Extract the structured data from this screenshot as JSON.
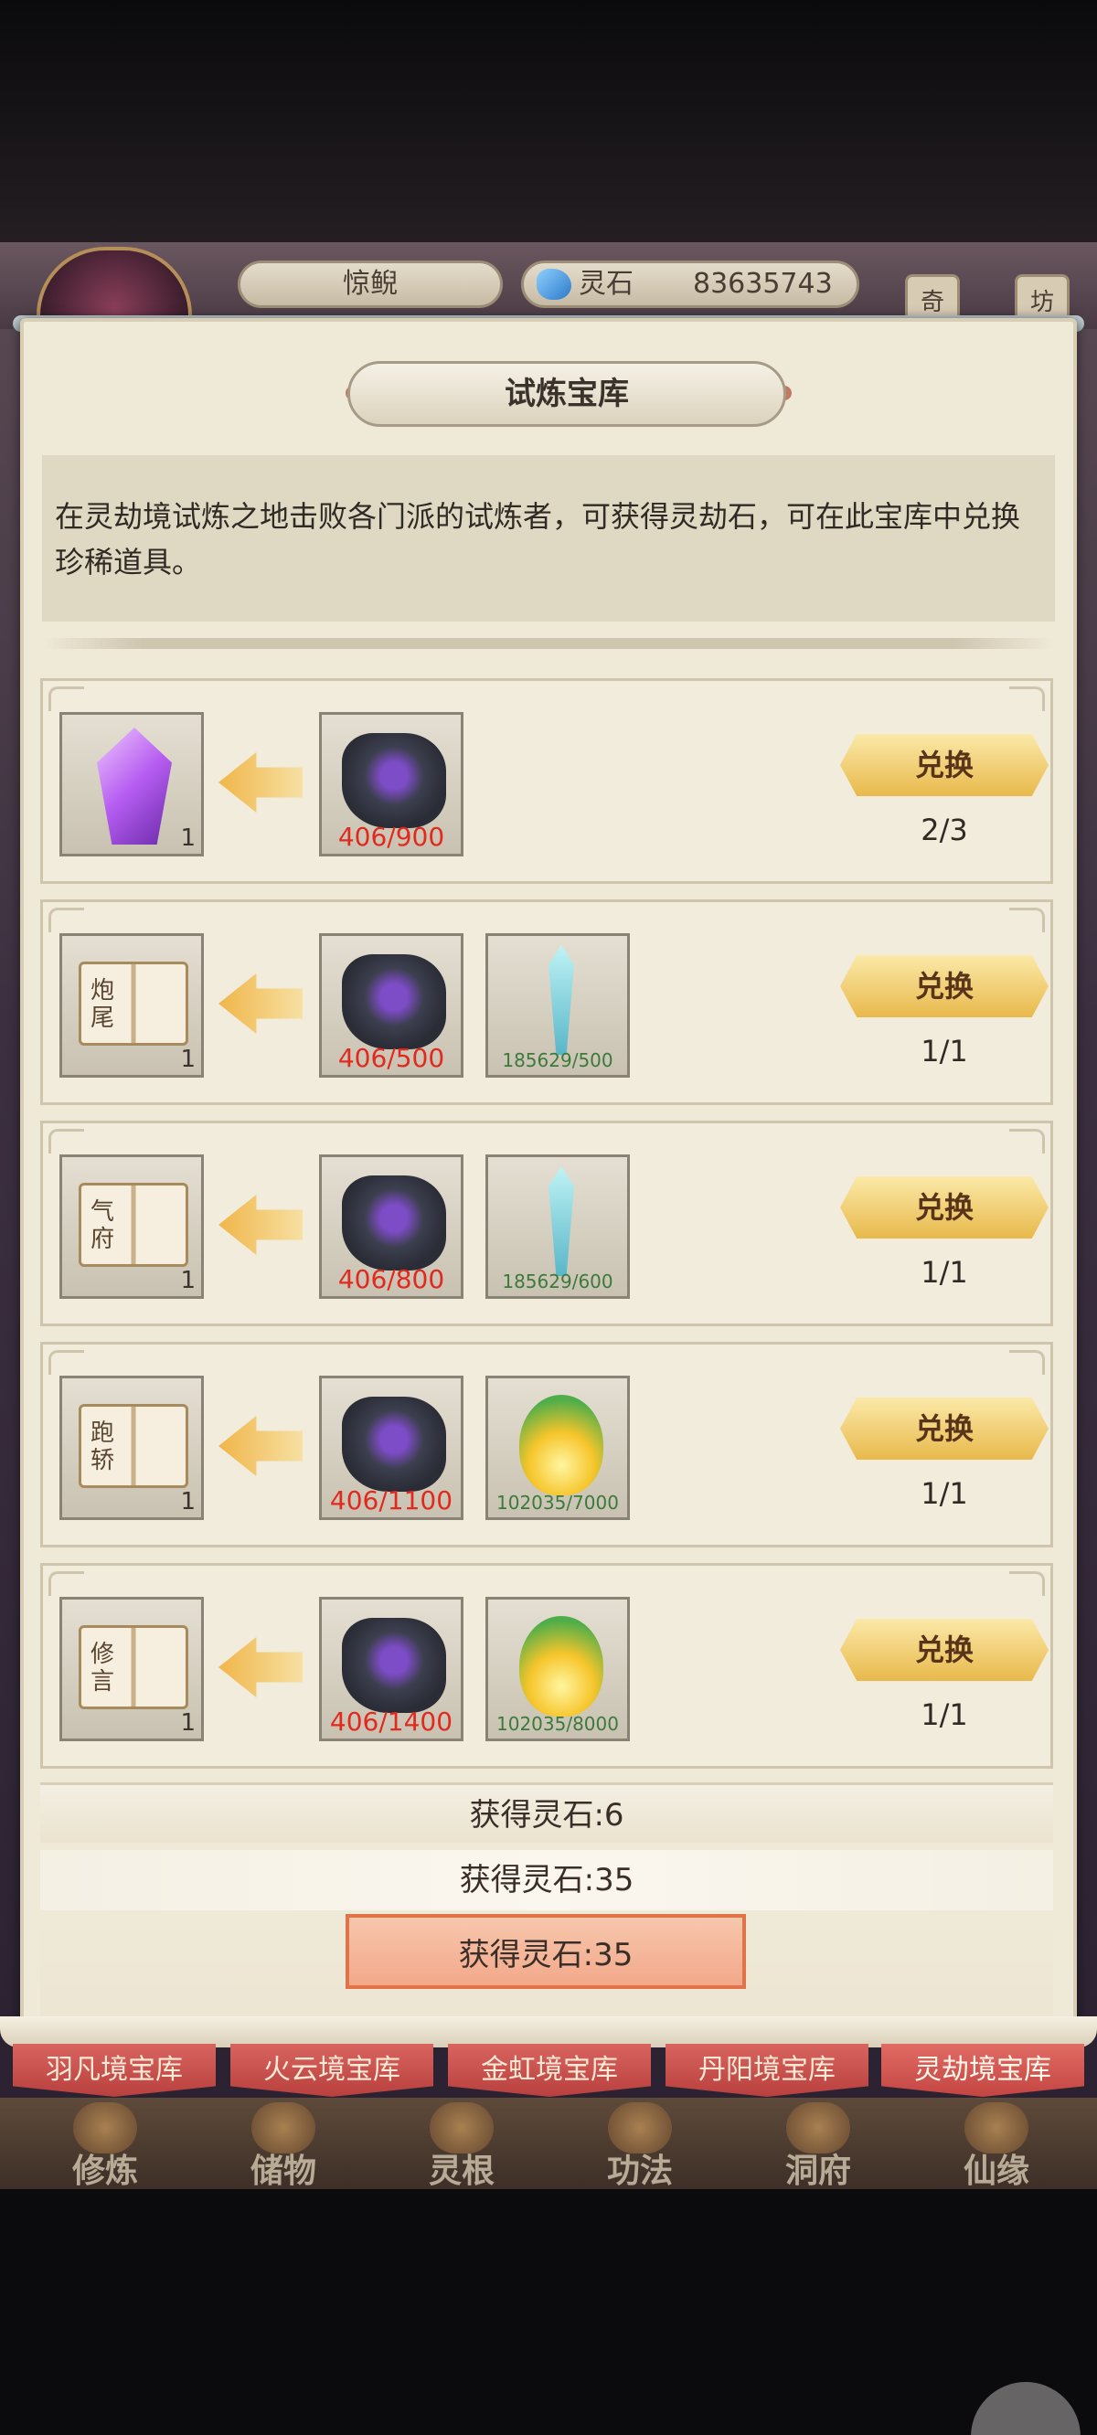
{
  "header": {
    "player_name": "惊鲵",
    "currency_label": "灵石",
    "currency_value": "83635743",
    "side_tags": [
      "奇",
      "坊"
    ]
  },
  "panel": {
    "title": "试炼宝库",
    "description": "在灵劫境试炼之地击败各门派的试炼者，可获得灵劫石，可在此宝库中兑换珍稀道具。"
  },
  "exchange_rows": [
    {
      "reward": {
        "icon": "purple-crystal-icon",
        "qty": "1",
        "glyph": ""
      },
      "costs": [
        {
          "icon": "spirit-rock-icon",
          "progress": "406/900"
        }
      ],
      "button": "兑换",
      "limit": "2/3"
    },
    {
      "reward": {
        "icon": "skill-book-icon",
        "qty": "1",
        "glyph": "炮尾"
      },
      "costs": [
        {
          "icon": "spirit-rock-icon",
          "progress": "406/500"
        },
        {
          "icon": "jade-sword-icon",
          "progress": "185629/500"
        }
      ],
      "button": "兑换",
      "limit": "1/1"
    },
    {
      "reward": {
        "icon": "skill-book-icon",
        "qty": "1",
        "glyph": "气府"
      },
      "costs": [
        {
          "icon": "spirit-rock-icon",
          "progress": "406/800"
        },
        {
          "icon": "jade-sword-icon",
          "progress": "185629/600"
        }
      ],
      "button": "兑换",
      "limit": "1/1"
    },
    {
      "reward": {
        "icon": "skill-book-icon",
        "qty": "1",
        "glyph": "跑轿"
      },
      "costs": [
        {
          "icon": "spirit-rock-icon",
          "progress": "406/1100"
        },
        {
          "icon": "spirit-fire-icon",
          "progress": "102035/7000"
        }
      ],
      "button": "兑换",
      "limit": "1/1"
    },
    {
      "reward": {
        "icon": "skill-book-icon",
        "qty": "1",
        "glyph": "修言"
      },
      "costs": [
        {
          "icon": "spirit-rock-icon",
          "progress": "406/1400"
        },
        {
          "icon": "spirit-fire-icon",
          "progress": "102035/8000"
        }
      ],
      "button": "兑换",
      "limit": "1/1"
    }
  ],
  "toasts": [
    "获得灵石:6",
    "获得灵石:35",
    "获得灵石:35"
  ],
  "tabs": [
    "羽凡境宝库",
    "火云境宝库",
    "金虹境宝库",
    "丹阳境宝库",
    "灵劫境宝库"
  ],
  "active_tab": "灵劫境宝库",
  "nav": [
    "修炼",
    "储物",
    "灵根",
    "功法",
    "洞府",
    "仙缘"
  ],
  "colors": {
    "need_red": "#e02a1e",
    "need_green": "#3c7a3a",
    "button_gold": "#e8b94c",
    "tab_red": "#c44542"
  }
}
